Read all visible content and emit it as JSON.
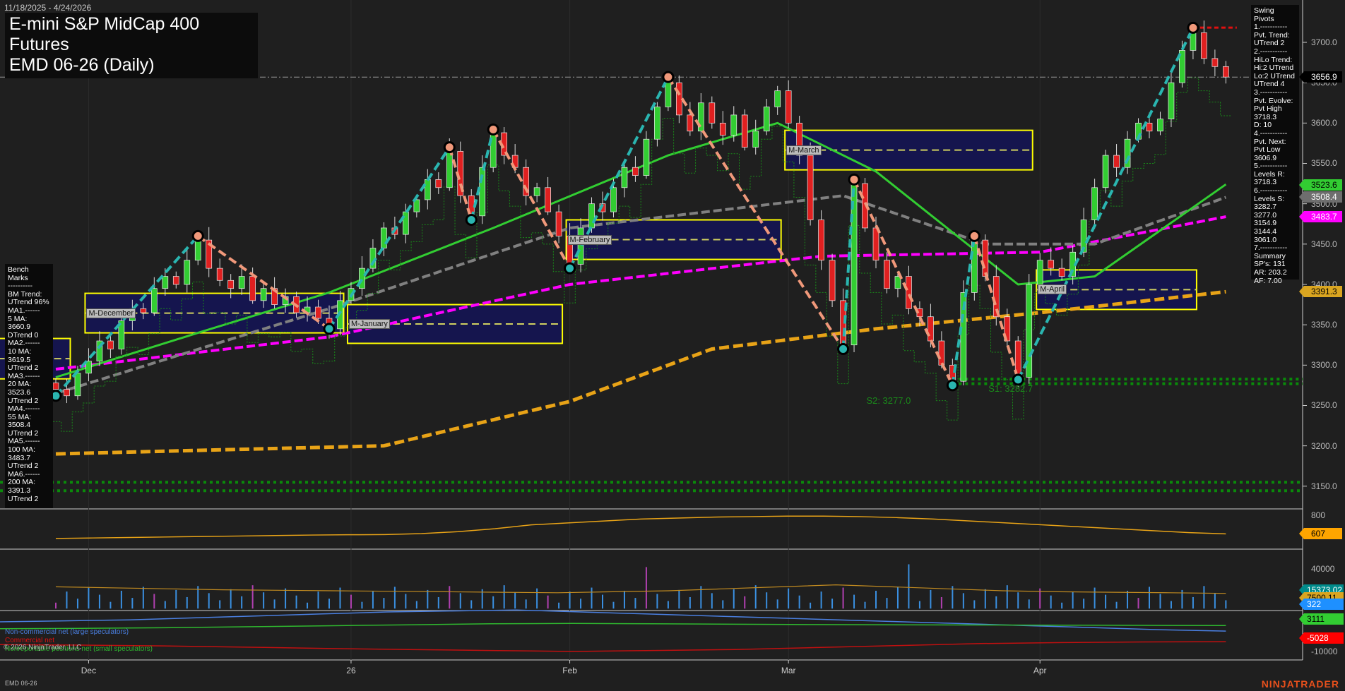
{
  "header": {
    "date_range": "11/18/2025 - 4/24/2026",
    "title_line1": "E-mini S&P MidCap 400 Futures",
    "title_line2": "EMD 06-26 (Daily)"
  },
  "swing_pivots_panel": [
    "Swing Pivots",
    "1.-----------",
    "Pvt. Trend:",
    "UTrend 2",
    "2.-----------",
    "HiLo Trend:",
    "Hi:2 UTrend",
    "Lo:2 UTrend",
    "UTrend 4",
    "3.-----------",
    "Pvt. Evolve:",
    "Pvt High",
    "3718.3",
    "D: 10",
    "4.-----------",
    "Pvt. Next:",
    "Pvt Low",
    "3606.9",
    "5.-----------",
    "Levels R:",
    "3718.3",
    "6.-----------",
    "Levels S:",
    "3282.7",
    "3277.0",
    "3154.9",
    "3144.4",
    "3061.0",
    "7.-----------",
    "Summary",
    "SP's: 131",
    "AR: 203.2",
    "AF: 7.00"
  ],
  "bench_marks_panel": [
    "Bench Marks",
    "----------",
    "BM Trend:",
    "UTrend 96%",
    "MA1.------",
    "5 MA:",
    "3660.9",
    "DTrend 0",
    "MA2.------",
    "10 MA:",
    "3619.5",
    "UTrend 2",
    "MA3.------",
    "20 MA:",
    "3523.6",
    "UTrend 2",
    "MA4.------",
    "55 MA:",
    "3508.4",
    "UTrend 2",
    "MA5.------",
    "100 MA:",
    "3483.7",
    "UTrend 2",
    "MA6.------",
    "200 MA:",
    "3391.3",
    "UTrend 2"
  ],
  "price_axis": {
    "ticks": [
      "3700.0",
      "3650.0",
      "3600.0",
      "3550.0",
      "3500.0",
      "3450.0",
      "3400.0",
      "3350.0",
      "3300.0",
      "3250.0",
      "3200.0",
      "3150.0"
    ],
    "tick_values": [
      3700,
      3650,
      3600,
      3550,
      3500,
      3450,
      3400,
      3350,
      3300,
      3250,
      3200,
      3150
    ],
    "badges": [
      {
        "label": "3656.9",
        "value": 3656.9,
        "bg": "#000000",
        "fg": "#ffffff",
        "border": "#cccccc"
      },
      {
        "label": "3523.6",
        "value": 3523.6,
        "bg": "#32cd32",
        "fg": "#000000",
        "border": "#32cd32"
      },
      {
        "label": "3508.4",
        "value": 3508.4,
        "bg": "#6e6e6e",
        "fg": "#ffffff",
        "border": "#aaaaaa"
      },
      {
        "label": "3483.7",
        "value": 3483.7,
        "bg": "#ff00ff",
        "fg": "#ffffff",
        "border": "#ff00ff"
      },
      {
        "label": "3391.3",
        "value": 3391.3,
        "bg": "#daa520",
        "fg": "#000000",
        "border": "#daa520"
      }
    ]
  },
  "indicator_axis": {
    "panel1_ticks": [
      "800"
    ],
    "panel1_badge": {
      "label": "607",
      "bg": "#ffa500",
      "fg": "#000000"
    },
    "panel2_ticks": [
      "40000",
      "-10000"
    ],
    "panel2_badges": [
      {
        "label": "15373.02",
        "bg": "#008b8b",
        "fg": "#ffffff"
      },
      {
        "label": "7500.11",
        "bg": "#daa520",
        "fg": "#000000"
      },
      {
        "label": "322",
        "bg": "#1e90ff",
        "fg": "#ffffff"
      },
      {
        "label": "3111",
        "bg": "#32cd32",
        "fg": "#000000"
      },
      {
        "label": "-5028",
        "bg": "#ff0000",
        "fg": "#ffffff"
      }
    ]
  },
  "time_axis": [
    {
      "label": "Dec",
      "bar": 3
    },
    {
      "label": "26",
      "bar": 27
    },
    {
      "label": "Feb",
      "bar": 47
    },
    {
      "label": "Mar",
      "bar": 67
    },
    {
      "label": "Apr",
      "bar": 90
    }
  ],
  "legend": {
    "noncommercial": "Non-commercial net (large speculators)",
    "commercial": "Commercial net",
    "nonreportable": "Nonreportable positions net (small speculators)",
    "copyright": "© 2026 NinjaTrader, LLC"
  },
  "footer": {
    "instrument": "EMD 06-26",
    "logo": "NINJATRADER"
  },
  "support_labels": [
    {
      "label": "S2: 3277.0",
      "value": 3277.0,
      "bar": 78
    },
    {
      "label": "S1: 3282.7",
      "value": 3282.7,
      "bar": 88
    }
  ],
  "colors": {
    "up": "#32cd32",
    "down": "#e02020",
    "ma20": "#32cd32",
    "ma55": "#808080",
    "ma100": "#ff00ff",
    "ma200": "#e8a317",
    "swing_up": "#2ab5b0",
    "swing_down": "#f0987a",
    "month_box": "#ffff00",
    "month_fill": "#15154e"
  },
  "chart_data": {
    "type": "candlestick",
    "title": "E-mini S&P MidCap 400 Futures EMD 06-26 (Daily)",
    "ylim": [
      3130,
      3745
    ],
    "closes": [
      3270,
      3262,
      3290,
      3305,
      3330,
      3320,
      3355,
      3370,
      3365,
      3395,
      3410,
      3400,
      3430,
      3455,
      3420,
      3405,
      3395,
      3410,
      3380,
      3395,
      3375,
      3385,
      3365,
      3372,
      3358,
      3345,
      3380,
      3395,
      3420,
      3445,
      3470,
      3462,
      3490,
      3505,
      3530,
      3520,
      3565,
      3510,
      3485,
      3545,
      3588,
      3560,
      3545,
      3510,
      3520,
      3490,
      3460,
      3425,
      3470,
      3500,
      3490,
      3520,
      3545,
      3535,
      3580,
      3620,
      3650,
      3610,
      3590,
      3625,
      3600,
      3585,
      3610,
      3570,
      3590,
      3620,
      3640,
      3600,
      3560,
      3480,
      3430,
      3380,
      3325,
      3525,
      3470,
      3430,
      3395,
      3410,
      3370,
      3360,
      3330,
      3300,
      3280,
      3390,
      3455,
      3410,
      3360,
      3330,
      3285,
      3400,
      3430,
      3420,
      3410,
      3440,
      3480,
      3520,
      3560,
      3545,
      3580,
      3600,
      3590,
      3605,
      3650,
      3690,
      3712,
      3680,
      3670,
      3657
    ],
    "moving_averages": {
      "ma20": [
        [
          0,
          3285
        ],
        [
          13,
          3340
        ],
        [
          25,
          3390
        ],
        [
          40,
          3470
        ],
        [
          56,
          3560
        ],
        [
          66,
          3600
        ],
        [
          75,
          3540
        ],
        [
          88,
          3400
        ],
        [
          95,
          3410
        ],
        [
          107,
          3524
        ]
      ],
      "ma55": [
        [
          0,
          3265
        ],
        [
          25,
          3370
        ],
        [
          47,
          3470
        ],
        [
          72,
          3510
        ],
        [
          85,
          3450
        ],
        [
          95,
          3450
        ],
        [
          107,
          3508
        ]
      ],
      "ma100": [
        [
          0,
          3295
        ],
        [
          25,
          3335
        ],
        [
          47,
          3400
        ],
        [
          70,
          3435
        ],
        [
          90,
          3440
        ],
        [
          107,
          3484
        ]
      ],
      "ma200": [
        [
          0,
          3190
        ],
        [
          30,
          3200
        ],
        [
          47,
          3255
        ],
        [
          60,
          3320
        ],
        [
          75,
          3345
        ],
        [
          90,
          3365
        ],
        [
          107,
          3391
        ]
      ]
    },
    "swing_pivots": [
      [
        0,
        3262,
        "L"
      ],
      [
        13,
        3460,
        "H"
      ],
      [
        25,
        3345,
        "L"
      ],
      [
        36,
        3570,
        "H"
      ],
      [
        38,
        3480,
        "L"
      ],
      [
        40,
        3592,
        "H"
      ],
      [
        47,
        3420,
        "L"
      ],
      [
        56,
        3657,
        "H"
      ],
      [
        72,
        3320,
        "L"
      ],
      [
        73,
        3530,
        "H"
      ],
      [
        82,
        3275,
        "L"
      ],
      [
        84,
        3460,
        "H"
      ],
      [
        88,
        3282,
        "L"
      ],
      [
        104,
        3718,
        "H"
      ]
    ],
    "month_ranges": [
      {
        "label": "",
        "start": -5,
        "end": 1,
        "high": 3333,
        "low": 3283
      },
      {
        "label": "M-December",
        "start": 3,
        "end": 26,
        "high": 3389,
        "low": 3340
      },
      {
        "label": "M-January",
        "start": 27,
        "end": 46,
        "high": 3375,
        "low": 3327
      },
      {
        "label": "M-February",
        "start": 47,
        "end": 66,
        "high": 3480,
        "low": 3431
      },
      {
        "label": "M-March",
        "start": 67,
        "end": 89,
        "high": 3591,
        "low": 3542
      },
      {
        "label": "M-April",
        "start": 90,
        "end": 104,
        "high": 3418,
        "low": 3369
      }
    ],
    "levels": {
      "last": 3656.9,
      "resistance": 3718.3,
      "support": [
        3282.7,
        3277.0,
        3154.9,
        3144.4
      ]
    },
    "oscillator": [
      560,
      565,
      570,
      575,
      580,
      585,
      590,
      595,
      598,
      600,
      610,
      630,
      660,
      700,
      720,
      740,
      760,
      770,
      780,
      785,
      790,
      790,
      785,
      775,
      760,
      740,
      720,
      700,
      680,
      660,
      640,
      620,
      607
    ],
    "volume_line": [
      22000,
      21000,
      20000,
      19000,
      18500,
      18000,
      17500,
      17000,
      16500,
      16000,
      17000,
      18000,
      20000,
      22000,
      24000,
      22000,
      20000,
      18000,
      17000,
      16500,
      16000,
      15373
    ],
    "cot_noncommercial": [
      5000,
      5500,
      6000,
      7000,
      8000,
      9000,
      10000,
      10500,
      11000,
      10000,
      9000,
      8000,
      7000,
      6000,
      5000,
      4000,
      3000,
      2000,
      1000,
      322
    ],
    "cot_nonreportable": [
      1500,
      1700,
      2000,
      2500,
      3000,
      3500,
      4000,
      4200,
      4000,
      3800,
      3600,
      3500,
      3400,
      3300,
      3200,
      3111
    ],
    "cot_commercial": [
      -6500,
      -6800,
      -7200,
      -7800,
      -8500,
      -9000,
      -9500,
      -10000,
      -9500,
      -9000,
      -8000,
      -7000,
      -6000,
      -5500,
      -5200,
      -5028
    ]
  }
}
